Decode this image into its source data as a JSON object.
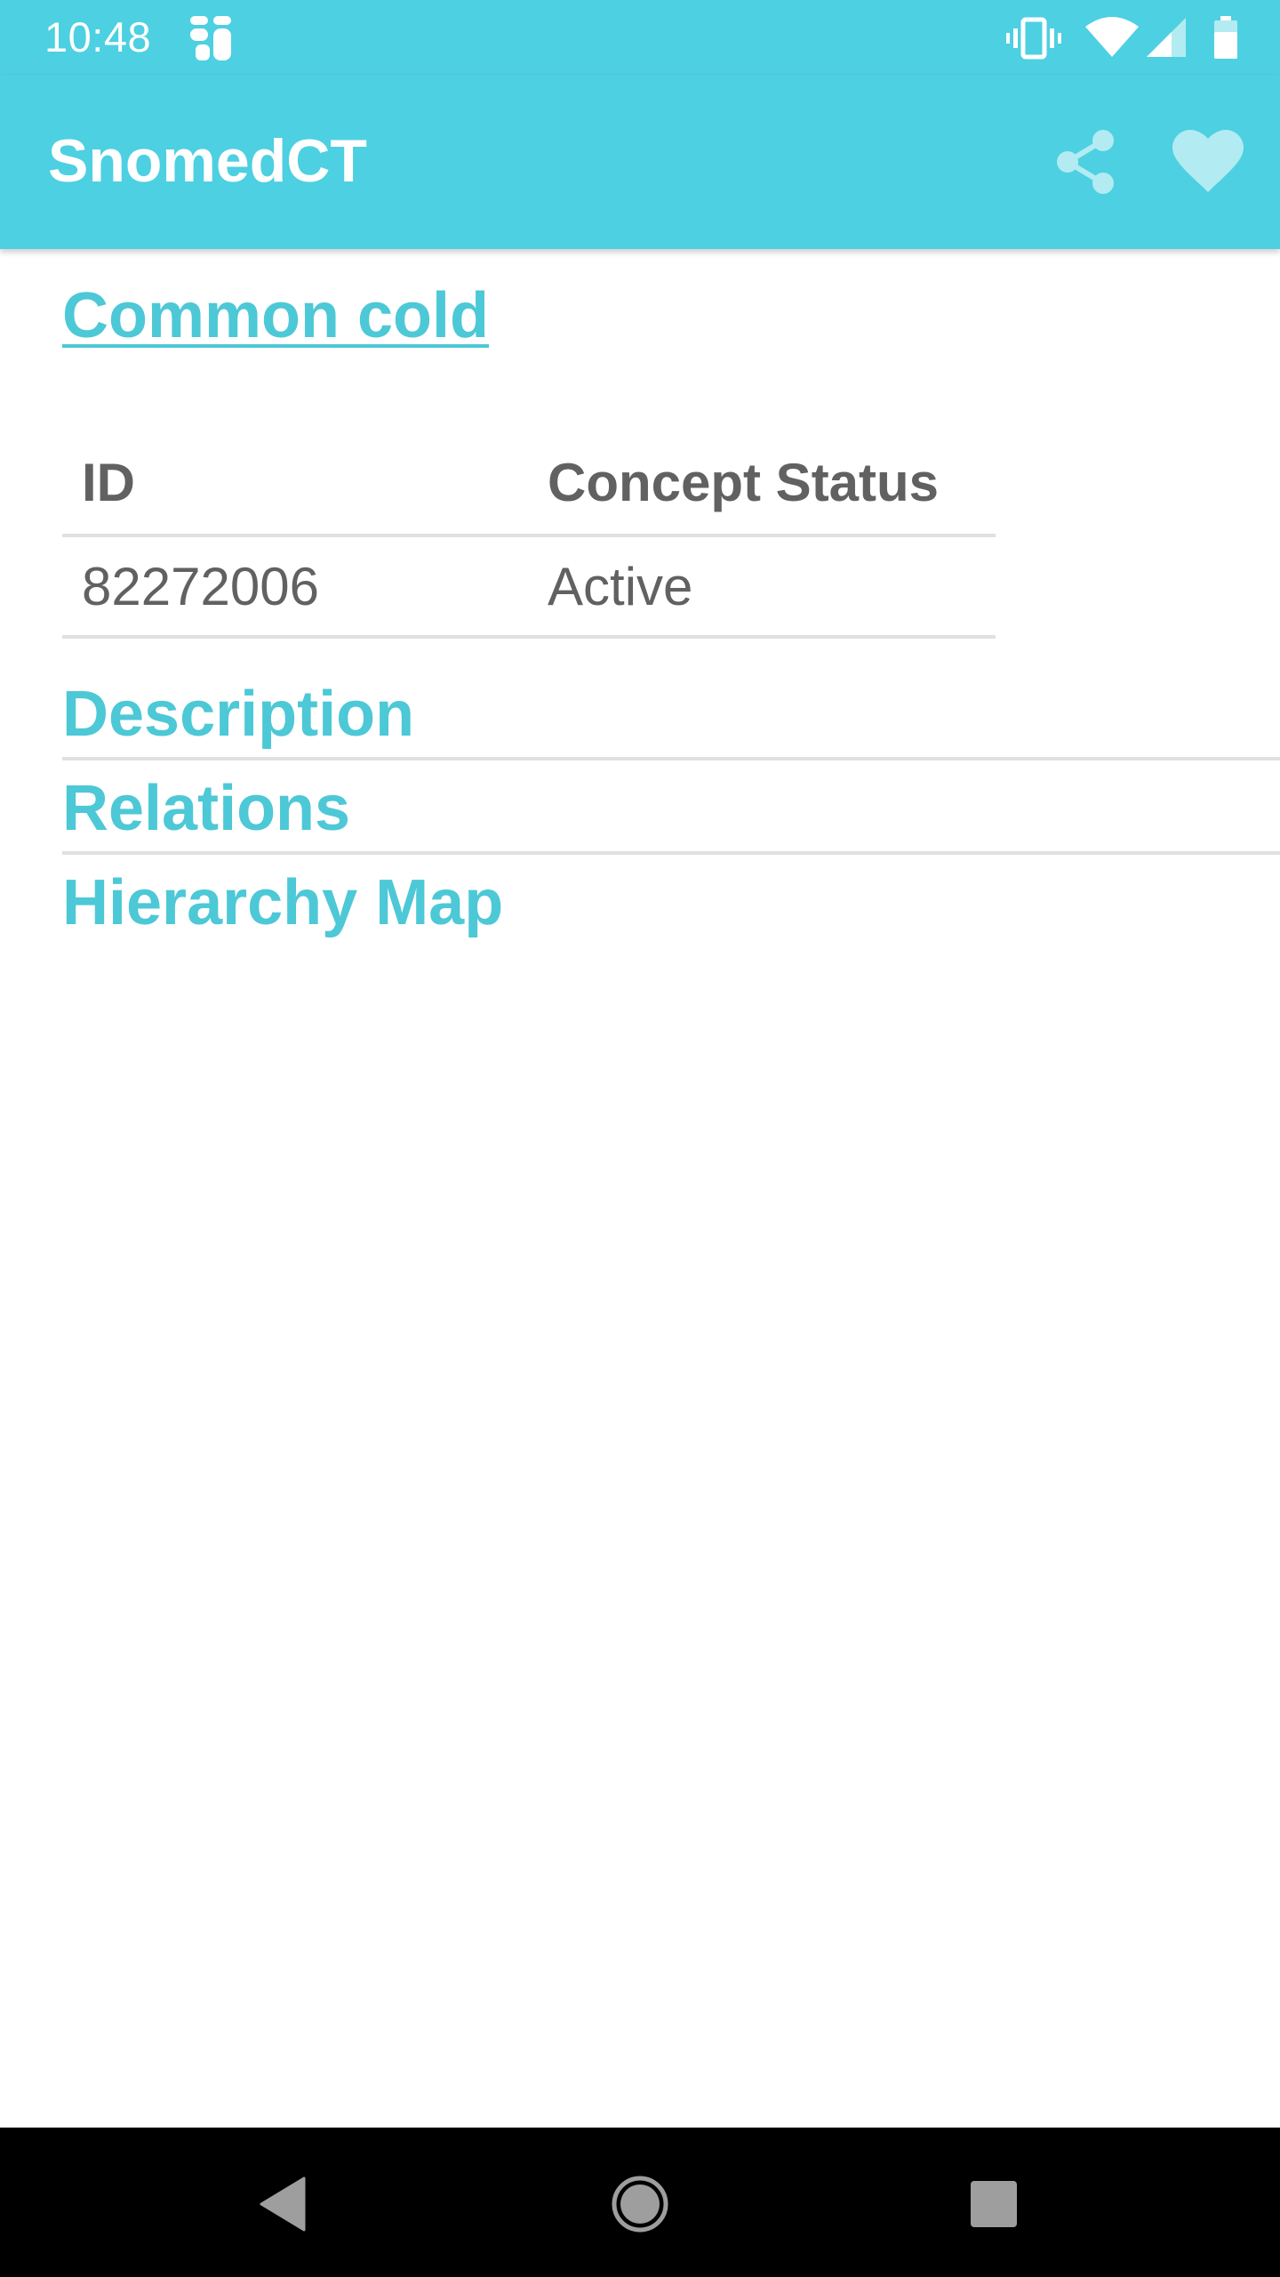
{
  "status_bar": {
    "time": "10:48",
    "icons": [
      "app-notification-icon",
      "vibrate-icon",
      "wifi-icon",
      "cell-signal-icon",
      "battery-icon"
    ]
  },
  "app_bar": {
    "title": "SnomedCT",
    "actions": [
      {
        "name": "share",
        "icon": "share-icon"
      },
      {
        "name": "favorite",
        "icon": "heart-icon"
      }
    ]
  },
  "concept": {
    "title": "Common cold",
    "table": {
      "headers": [
        "ID",
        "Concept Status"
      ],
      "rows": [
        [
          "82272006",
          "Active"
        ]
      ]
    }
  },
  "sections": {
    "description": "Description",
    "relations": "Relations",
    "hierarchy_map": "Hierarchy Map"
  },
  "nav_bar": {
    "buttons": [
      "back-icon",
      "home-icon",
      "recents-icon"
    ]
  },
  "colors": {
    "primary": "#4dd0e1",
    "accent_text": "#4dc8d6",
    "table_text": "#616161",
    "divider": "#e0e0e0",
    "favorite_icon": "#b2ebf2"
  }
}
